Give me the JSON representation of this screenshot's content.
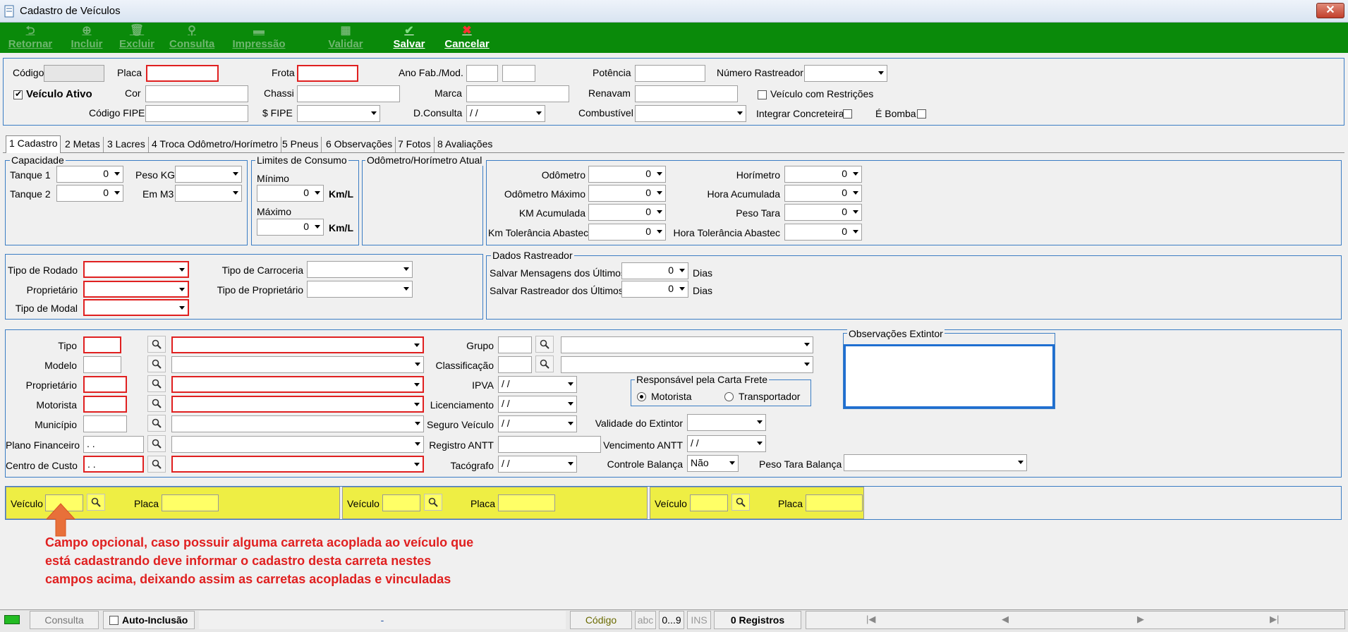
{
  "window": {
    "title": "Cadastro de Veículos",
    "close_label": "✕"
  },
  "toolbar": {
    "retornar": "Retornar",
    "incluir": "Incluir",
    "excluir": "Excluir",
    "consulta": "Consulta",
    "impressao": "Impressão",
    "validar": "Validar",
    "salvar": "Salvar",
    "cancelar": "Cancelar"
  },
  "header": {
    "codigo": "Código",
    "placa": "Placa",
    "frota": "Frota",
    "ano": "Ano Fab./Mod.",
    "potencia": "Potência",
    "numero_rastreador": "Número Rastreador",
    "veiculo_ativo": "Veículo Ativo",
    "cor": "Cor",
    "chassi": "Chassi",
    "marca": "Marca",
    "renavam": "Renavam",
    "veiculo_restricoes": "Veículo com Restrições",
    "codigo_fipe": "Código FIPE",
    "valor_fipe": "$ FIPE",
    "dconsulta": "D.Consulta",
    "dconsulta_value": " / /",
    "combustivel": "Combustível",
    "integrar_concreteira": "Integrar Concreteira",
    "e_bomba": "É Bomba"
  },
  "tabs": [
    "1 Cadastro",
    "2 Metas",
    "3 Lacres",
    "4 Troca Odômetro/Horímetro",
    "5 Pneus",
    "6 Observações",
    "7 Fotos",
    "8 Avaliações"
  ],
  "capacidade": {
    "legend": "Capacidade",
    "tanque1": "Tanque 1",
    "tanque2": "Tanque 2",
    "peso_kg": "Peso KG",
    "em_m3": "Em M3",
    "zero": "0"
  },
  "limites": {
    "legend": "Limites de Consumo",
    "minimo": "Mínimo",
    "maximo": "Máximo",
    "unit": "Km/L",
    "zero": "0"
  },
  "odometro_atual": {
    "legend": "Odômetro/Horímetro Atual"
  },
  "odometro": {
    "odometro": "Odômetro",
    "odometro_maximo": "Odômetro Máximo",
    "km_acumulada": "KM Acumulada",
    "km_tolerancia": "Km Tolerância Abastec",
    "horimetro": "Horímetro",
    "hora_acumulada": "Hora Acumulada",
    "peso_tara": "Peso Tara",
    "hora_tolerancia": "Hora Tolerância Abastec",
    "zero": "0"
  },
  "rodado": {
    "tipo_rodado": "Tipo de Rodado",
    "proprietario": "Proprietário",
    "tipo_modal": "Tipo de Modal",
    "tipo_carroceria": "Tipo de Carroceria",
    "tipo_proprietario": "Tipo de Proprietário"
  },
  "rastreador": {
    "legend": "Dados Rastreador",
    "salvar_mensagens": "Salvar Mensagens dos Últimos",
    "salvar_rastreador": "Salvar Rastreador dos Últimos",
    "dias": "Dias",
    "zero": "0"
  },
  "detalhes": {
    "tipo": "Tipo",
    "modelo": "Modelo",
    "proprietario": "Proprietário",
    "motorista": "Motorista",
    "municipio": "Município",
    "plano_financeiro": "Plano Financeiro",
    "centro_custo": "Centro de Custo",
    "dots": " .  .",
    "grupo": "Grupo",
    "classificacao": "Classificação",
    "ipva": "IPVA",
    "licenciamento": "Licenciamento",
    "seguro_veiculo": "Seguro Veículo",
    "registro_antt": "Registro ANTT",
    "tacografo": "Tacógrafo",
    "date_empty": " / /",
    "responsavel_legend": "Responsável pela Carta Frete",
    "opt_motorista": "Motorista",
    "opt_transportador": "Transportador",
    "validade_extintor": "Validade do Extintor",
    "vencimento_antt": "Vencimento ANTT",
    "controle_balanca": "Controle Balança",
    "controle_balanca_value": "Não",
    "peso_tara_balanca": "Peso Tara Balança",
    "obs_extintor_legend": "Observações Extintor"
  },
  "carretas": {
    "veiculo": "Veículo",
    "placa": "Placa"
  },
  "note": {
    "line1": "Campo opcional, caso possuir alguma carreta acoplada ao veículo que",
    "line2": "está cadastrando deve informar o cadastro desta carreta nestes",
    "line3": "campos acima, deixando assim as carretas acopladas e vinculadas"
  },
  "statusbar": {
    "mode": "Consulta",
    "auto_inclusao": "Auto-Inclusão",
    "dash": "-",
    "codigo": "Código",
    "abc": "abc",
    "digits": "0...9",
    "ins": "INS",
    "registros": "0 Registros",
    "first": "|◀",
    "prev": "◀",
    "next": "▶",
    "last": "▶|"
  },
  "colors": {
    "toolbar": "#0a8a0a",
    "required_border": "#e02020",
    "yellow_panel": "#eeee44",
    "panel_border": "#3b7dc4",
    "note": "#e02020"
  }
}
